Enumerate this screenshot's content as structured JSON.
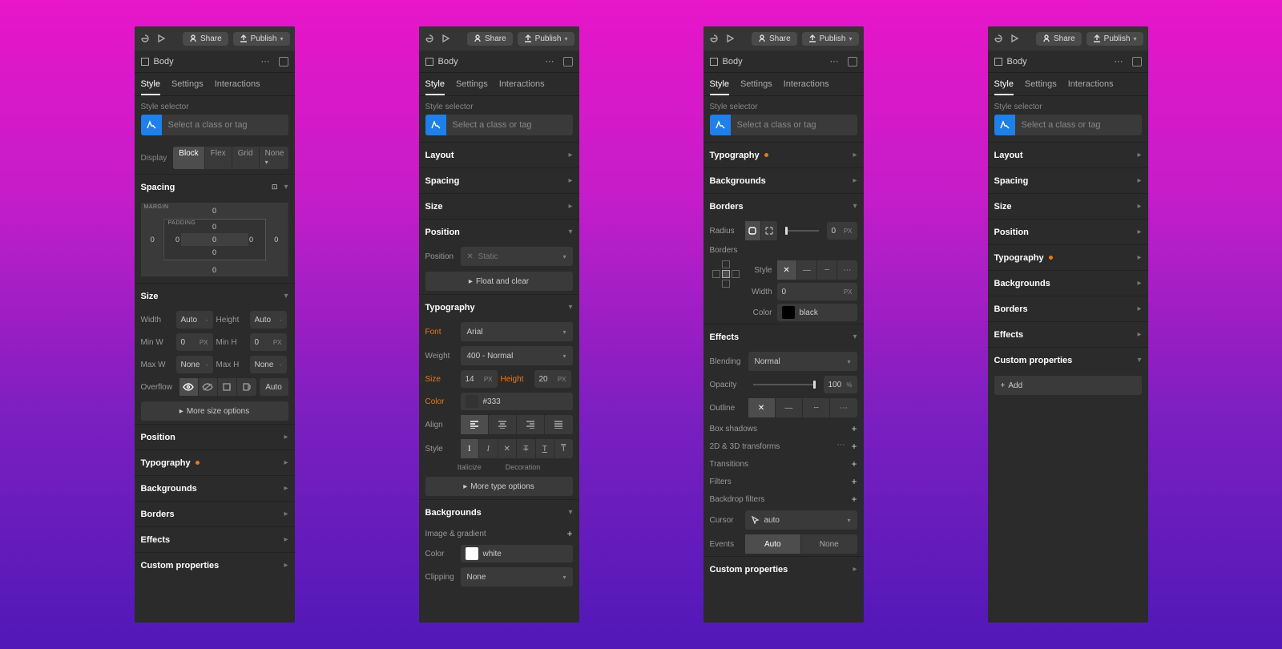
{
  "topbar": {
    "share": "Share",
    "publish": "Publish"
  },
  "crumb": {
    "title": "Body"
  },
  "tabs": {
    "style": "Style",
    "settings": "Settings",
    "interactions": "Interactions"
  },
  "styleSelector": {
    "label": "Style selector",
    "placeholder": "Select a class or tag"
  },
  "display": {
    "label": "Display",
    "options": {
      "block": "Block",
      "flex": "Flex",
      "grid": "Grid",
      "none": "None"
    }
  },
  "sections": {
    "layout": "Layout",
    "spacing": "Spacing",
    "size": "Size",
    "position": "Position",
    "typography": "Typography",
    "backgrounds": "Backgrounds",
    "borders": "Borders",
    "effects": "Effects",
    "custom": "Custom properties"
  },
  "spacing": {
    "margin": "MARGIN",
    "padding": "PADDING",
    "zero": "0"
  },
  "size": {
    "width": "Width",
    "height": "Height",
    "minW": "Min W",
    "minH": "Min H",
    "maxW": "Max W",
    "maxH": "Max H",
    "auto": "Auto",
    "none": "None",
    "zero": "0",
    "px": "PX",
    "overflow": "Overflow",
    "overflowAuto": "Auto",
    "more": "More size options"
  },
  "position": {
    "label": "Position",
    "static": "Static",
    "floatClear": "Float and clear"
  },
  "typo": {
    "font": "Font",
    "fontVal": "Arial",
    "weight": "Weight",
    "weightVal": "400 - Normal",
    "size": "Size",
    "sizeVal": "14",
    "height": "Height",
    "heightVal": "20",
    "color": "Color",
    "colorVal": "#333",
    "align": "Align",
    "style": "Style",
    "italicize": "Italicize",
    "decoration": "Decoration",
    "more": "More type options",
    "px": "PX"
  },
  "bg": {
    "img": "Image & gradient",
    "color": "Color",
    "colorVal": "white",
    "clipping": "Clipping",
    "clippingVal": "None"
  },
  "borders": {
    "radius": "Radius",
    "radiusVal": "0",
    "label": "Borders",
    "style": "Style",
    "width": "Width",
    "widthVal": "0",
    "color": "Color",
    "colorVal": "black",
    "px": "PX"
  },
  "effects": {
    "blending": "Blending",
    "blendingVal": "Normal",
    "opacity": "Opacity",
    "opacityVal": "100",
    "pct": "%",
    "outline": "Outline",
    "boxShadows": "Box shadows",
    "transforms": "2D & 3D transforms",
    "transitions": "Transitions",
    "filters": "Filters",
    "backdrop": "Backdrop filters",
    "cursor": "Cursor",
    "cursorVal": "auto",
    "events": "Events",
    "eventsAuto": "Auto",
    "eventsNone": "None"
  },
  "custom": {
    "add": "Add"
  }
}
